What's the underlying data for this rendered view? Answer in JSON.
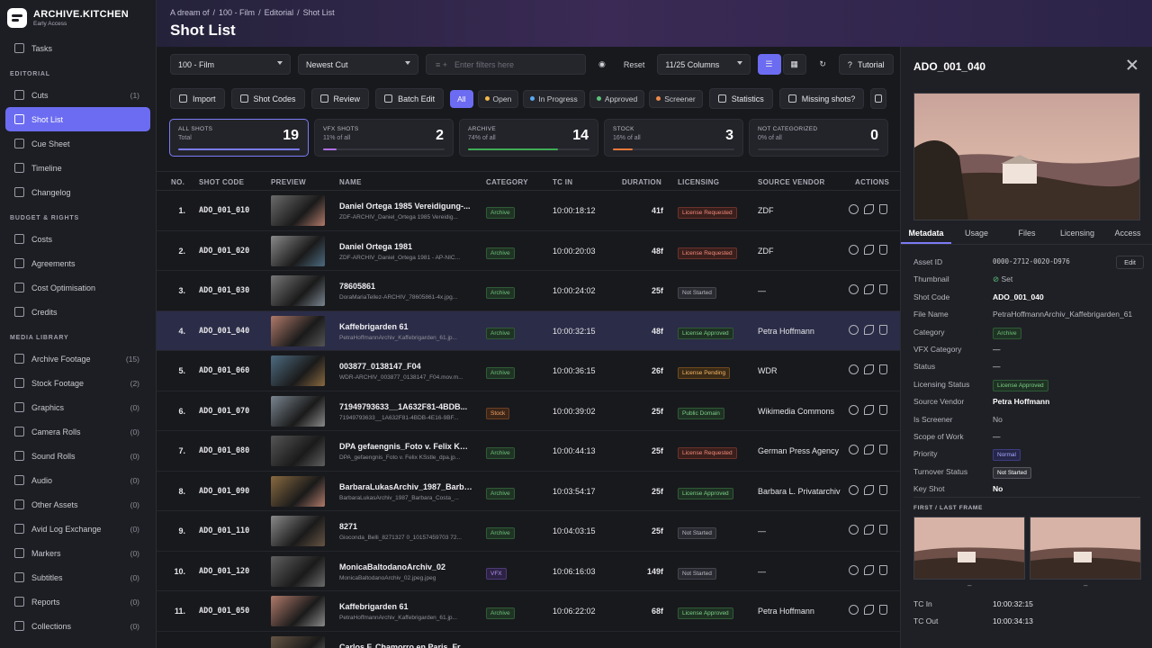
{
  "brand": {
    "name": "ARCHIVE.KITCHEN",
    "sub": "Early Access"
  },
  "sidebar": {
    "top": [
      {
        "label": "Tasks",
        "count": ""
      }
    ],
    "sections": [
      {
        "title": "EDITORIAL",
        "items": [
          {
            "label": "Cuts",
            "count": "(1)"
          },
          {
            "label": "Shot List",
            "count": "",
            "active": true
          },
          {
            "label": "Cue Sheet",
            "count": ""
          },
          {
            "label": "Timeline",
            "count": ""
          },
          {
            "label": "Changelog",
            "count": ""
          }
        ]
      },
      {
        "title": "BUDGET & RIGHTS",
        "items": [
          {
            "label": "Costs",
            "count": ""
          },
          {
            "label": "Agreements",
            "count": ""
          },
          {
            "label": "Cost Optimisation",
            "count": ""
          },
          {
            "label": "Credits",
            "count": ""
          }
        ]
      },
      {
        "title": "MEDIA LIBRARY",
        "items": [
          {
            "label": "Archive Footage",
            "count": "(15)"
          },
          {
            "label": "Stock Footage",
            "count": "(2)"
          },
          {
            "label": "Graphics",
            "count": "(0)"
          },
          {
            "label": "Camera Rolls",
            "count": "(0)"
          },
          {
            "label": "Sound Rolls",
            "count": "(0)"
          },
          {
            "label": "Audio",
            "count": "(0)"
          },
          {
            "label": "Other Assets",
            "count": "(0)"
          },
          {
            "label": "Avid Log Exchange",
            "count": "(0)"
          },
          {
            "label": "Markers",
            "count": "(0)"
          },
          {
            "label": "Subtitles",
            "count": "(0)"
          },
          {
            "label": "Reports",
            "count": "(0)"
          },
          {
            "label": "Collections",
            "count": "(0)"
          }
        ]
      }
    ]
  },
  "header": {
    "breadcrumb": [
      "A dream of",
      "/",
      "100 - Film",
      "/",
      "Editorial",
      "/",
      "Shot List"
    ],
    "title": "Shot List"
  },
  "filters": {
    "project": "100 - Film",
    "sort": "Newest Cut",
    "filter_placeholder": "Enter filters here",
    "reset": "Reset",
    "columns": "11/25 Columns",
    "tutorial": "Tutorial"
  },
  "toolbar": {
    "import": "Import",
    "shot_codes": "Shot Codes",
    "review": "Review",
    "batch_edit": "Batch Edit",
    "chips": [
      {
        "label": "All",
        "color": ""
      },
      {
        "label": "Open",
        "color": "#f5b84a"
      },
      {
        "label": "In Progress",
        "color": "#5aa9f0"
      },
      {
        "label": "Approved",
        "color": "#5cc27a"
      },
      {
        "label": "Screener",
        "color": "#f08a4a"
      }
    ],
    "statistics": "Statistics",
    "missing": "Missing shots?"
  },
  "cards": [
    {
      "label": "ALL SHOTS",
      "sub": "Total",
      "value": "19",
      "fill": 1.0,
      "color": "#7b7bf5"
    },
    {
      "label": "VFX SHOTS",
      "sub": "11% of all",
      "value": "2",
      "fill": 0.11,
      "color": "#b070e8"
    },
    {
      "label": "ARCHIVE",
      "sub": "74% of all",
      "value": "14",
      "fill": 0.74,
      "color": "#3fae55"
    },
    {
      "label": "STOCK",
      "sub": "16% of all",
      "value": "3",
      "fill": 0.16,
      "color": "#f07a3a"
    },
    {
      "label": "NOT CATEGORIZED",
      "sub": "0% of all",
      "value": "0",
      "fill": 0,
      "color": "#7b7bf5"
    }
  ],
  "columns": {
    "no": "NO.",
    "code": "SHOT CODE",
    "preview": "PREVIEW",
    "name": "NAME",
    "category": "CATEGORY",
    "tc": "TC IN",
    "duration": "DURATION",
    "licensing": "LICENSING",
    "vendor": "SOURCE VENDOR",
    "actions": "ACTIONS"
  },
  "rows": [
    {
      "no": "1.",
      "code": "ADO_001_010",
      "name": "Daniel Ortega 1985 Vereidigung-...",
      "file": "ZDF-ARCHIV_Daniel_Ortega 1985 Vereidig...",
      "category": "Archive",
      "tc": "10:00:18:12",
      "duration": "41f",
      "licensing": "License Requested",
      "vendor": "ZDF"
    },
    {
      "no": "2.",
      "code": "ADO_001_020",
      "name": "Daniel Ortega 1981",
      "file": "ZDF-ARCHIV_Daniel_Ortega 1981 - AP-NIC...",
      "category": "Archive",
      "tc": "10:00:20:03",
      "duration": "48f",
      "licensing": "License Requested",
      "vendor": "ZDF"
    },
    {
      "no": "3.",
      "code": "ADO_001_030",
      "name": "78605861",
      "file": "DoraMariaTellez-ARCHIV_78605861-4x.jpg...",
      "category": "Archive",
      "tc": "10:00:24:02",
      "duration": "25f",
      "licensing": "Not Started",
      "vendor": "—"
    },
    {
      "no": "4.",
      "code": "ADO_001_040",
      "name": "Kaffebrigarden 61",
      "file": "PetraHoffmannArchiv_Kaffebrigarden_61.jp...",
      "category": "Archive",
      "tc": "10:00:32:15",
      "duration": "48f",
      "licensing": "License Approved",
      "vendor": "Petra Hoffmann",
      "highlight": true
    },
    {
      "no": "5.",
      "code": "ADO_001_060",
      "name": "003877_0138147_F04",
      "file": "WDR-ARCHIV_003877_0138147_F04.mov.m...",
      "category": "Archive",
      "tc": "10:00:36:15",
      "duration": "26f",
      "licensing": "License Pending",
      "vendor": "WDR"
    },
    {
      "no": "6.",
      "code": "ADO_001_070",
      "name": "71949793633__1A632F81-4BDB...",
      "file": "71949793633__1A632F81-4BDB-4E16-9BF...",
      "category": "Stock",
      "tc": "10:00:39:02",
      "duration": "25f",
      "licensing": "Public Domain",
      "vendor": "Wikimedia Commons"
    },
    {
      "no": "7.",
      "code": "ADO_001_080",
      "name": "DPA gefaengnis_Foto v. Felix KŠst...",
      "file": "DPA_gefaengnis_Foto v. Felix KŠstle_dpa.jp...",
      "category": "Archive",
      "tc": "10:00:44:13",
      "duration": "25f",
      "licensing": "License Requested",
      "vendor": "German Press Agency"
    },
    {
      "no": "8.",
      "code": "ADO_001_090",
      "name": "BarbaraLukasArchiv_1987_Barbar...",
      "file": "BarbaraLukasArchiv_1987_Barbara_Costa_...",
      "category": "Archive",
      "tc": "10:03:54:17",
      "duration": "25f",
      "licensing": "License Approved",
      "vendor": "Barbara L. Privatarchiv"
    },
    {
      "no": "9.",
      "code": "ADO_001_110",
      "name": "8271",
      "file": "Gioconda_Belli_8271327 0_10157459703 72...",
      "category": "Archive",
      "tc": "10:04:03:15",
      "duration": "25f",
      "licensing": "Not Started",
      "vendor": "—"
    },
    {
      "no": "10.",
      "code": "ADO_001_120",
      "name": "MonicaBaltodanoArchiv_02",
      "file": "MonicaBaltodanoArchiv_02.jpeg.jpeg",
      "category": "VFX",
      "tc": "10:06:16:03",
      "duration": "149f",
      "licensing": "Not Started",
      "vendor": "—"
    },
    {
      "no": "11.",
      "code": "ADO_001_050",
      "name": "Kaffebrigarden 61",
      "file": "PetraHoffmannArchiv_Kaffebrigarden_61.jp...",
      "category": "Archive",
      "tc": "10:06:22:02",
      "duration": "68f",
      "licensing": "License Approved",
      "vendor": "Petra Hoffmann"
    },
    {
      "no": "",
      "code": "",
      "name": "Carlos F. Chamorro en Paris_Fran...",
      "file": "",
      "category": "",
      "tc": "",
      "duration": "",
      "licensing": "",
      "vendor": ""
    }
  ],
  "panel": {
    "title": "ADO_001_040",
    "tabs": [
      "Metadata",
      "Usage",
      "Files",
      "Licensing",
      "Access"
    ],
    "edit": "Edit",
    "meta": [
      {
        "k": "Asset ID",
        "v": "0000-2712-0020-D976",
        "type": "mono"
      },
      {
        "k": "Thumbnail",
        "v": "Set",
        "type": "set"
      },
      {
        "k": "Shot Code",
        "v": "ADO_001_040",
        "type": "strong"
      },
      {
        "k": "File Name",
        "v": "PetraHoffmannArchiv_Kaffebrigarden_61",
        "type": "dim"
      },
      {
        "k": "Category",
        "v": "Archive",
        "type": "badge-archive"
      },
      {
        "k": "VFX Category",
        "v": "—",
        "type": ""
      },
      {
        "k": "Status",
        "v": "—",
        "type": ""
      },
      {
        "k": "Licensing Status",
        "v": "License Approved",
        "type": "badge-lic"
      },
      {
        "k": "Source Vendor",
        "v": "Petra Hoffmann",
        "type": "strong"
      },
      {
        "k": "Is Screener",
        "v": "No",
        "type": "dim"
      },
      {
        "k": "Scope of Work",
        "v": "—",
        "type": ""
      },
      {
        "k": "Priority",
        "v": "Normal",
        "type": "badge-normal"
      },
      {
        "k": "Turnover Status",
        "v": "Not Started",
        "type": "badge-ns"
      },
      {
        "k": "Key Shot",
        "v": "No",
        "type": "strong"
      }
    ],
    "first_last_label": "FIRST / LAST FRAME",
    "first_dash": "–",
    "last_dash": "–",
    "tc_in_label": "TC In",
    "tc_in": "10:00:32:15",
    "tc_out_label": "TC Out",
    "tc_out": "10:00:34:13"
  }
}
